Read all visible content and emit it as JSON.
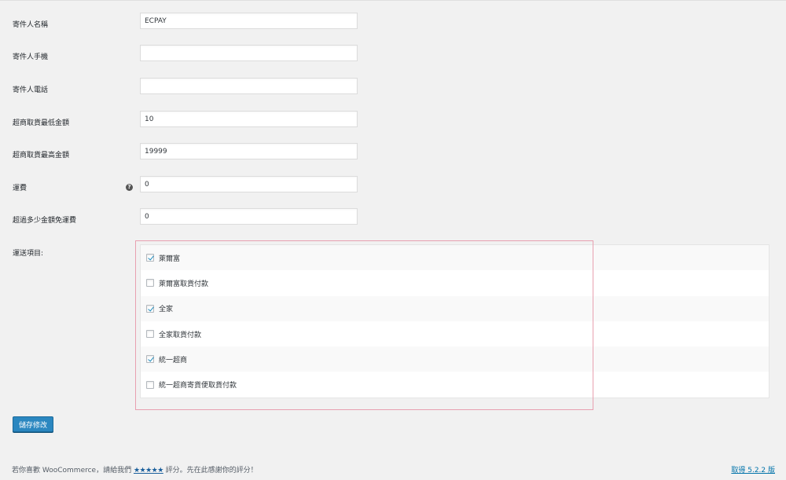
{
  "form": {
    "fields": [
      {
        "label": "寄件人名稱",
        "value": "ECPAY"
      },
      {
        "label": "寄件人手機",
        "value": ""
      },
      {
        "label": "寄件人電話",
        "value": ""
      },
      {
        "label": "超商取貨最低金額",
        "value": "10"
      },
      {
        "label": "超商取貨最高金額",
        "value": "19999"
      },
      {
        "label": "運費",
        "value": "0",
        "help": "?"
      },
      {
        "label": "超過多少金額免運費",
        "value": "0"
      }
    ]
  },
  "shipping_methods": {
    "label": "運送項目:",
    "items": [
      {
        "label": "萊爾富",
        "checked": true
      },
      {
        "label": "萊爾富取貨付款",
        "checked": false
      },
      {
        "label": "全家",
        "checked": true
      },
      {
        "label": "全家取貨付款",
        "checked": false
      },
      {
        "label": "統一超商",
        "checked": true
      },
      {
        "label": "統一超商寄貨便取貨付款",
        "checked": false
      }
    ]
  },
  "save_button": {
    "label": "儲存修改"
  },
  "footer": {
    "text_before": "若你喜歡 WooCommerce，請給我們 ",
    "stars": "★★★★★",
    "text_after": " 評分。先在此感謝你的評分！",
    "version": "取得 5.2.2 版"
  },
  "colors": {
    "accent": "#2b87c0",
    "highlight_border": "#e8a0b0",
    "link": "#0073aa"
  }
}
